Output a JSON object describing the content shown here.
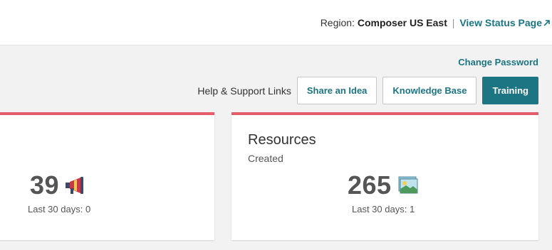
{
  "header": {
    "region_label": "Region:",
    "region_value": "Composer US East",
    "separator": "|",
    "status_link": "View Status Page",
    "status_link_icon": "external-link-icon"
  },
  "account": {
    "change_password": "Change Password"
  },
  "help": {
    "label": "Help & Support Links",
    "buttons": [
      {
        "label": "Share an Idea"
      },
      {
        "label": "Knowledge Base"
      },
      {
        "label": "Training"
      }
    ]
  },
  "cards": [
    {
      "value": "39",
      "icon": "megaphone-icon",
      "last_30_days": "Last 30 days: 0"
    },
    {
      "title": "Resources",
      "subtitle": "Created",
      "value": "265",
      "icon": "picture-icon",
      "last_30_days": "Last 30 days: 1"
    }
  ],
  "colors": {
    "accent": "#1c7583",
    "card_border": "#e55d6b",
    "background": "#f2f2f2"
  }
}
